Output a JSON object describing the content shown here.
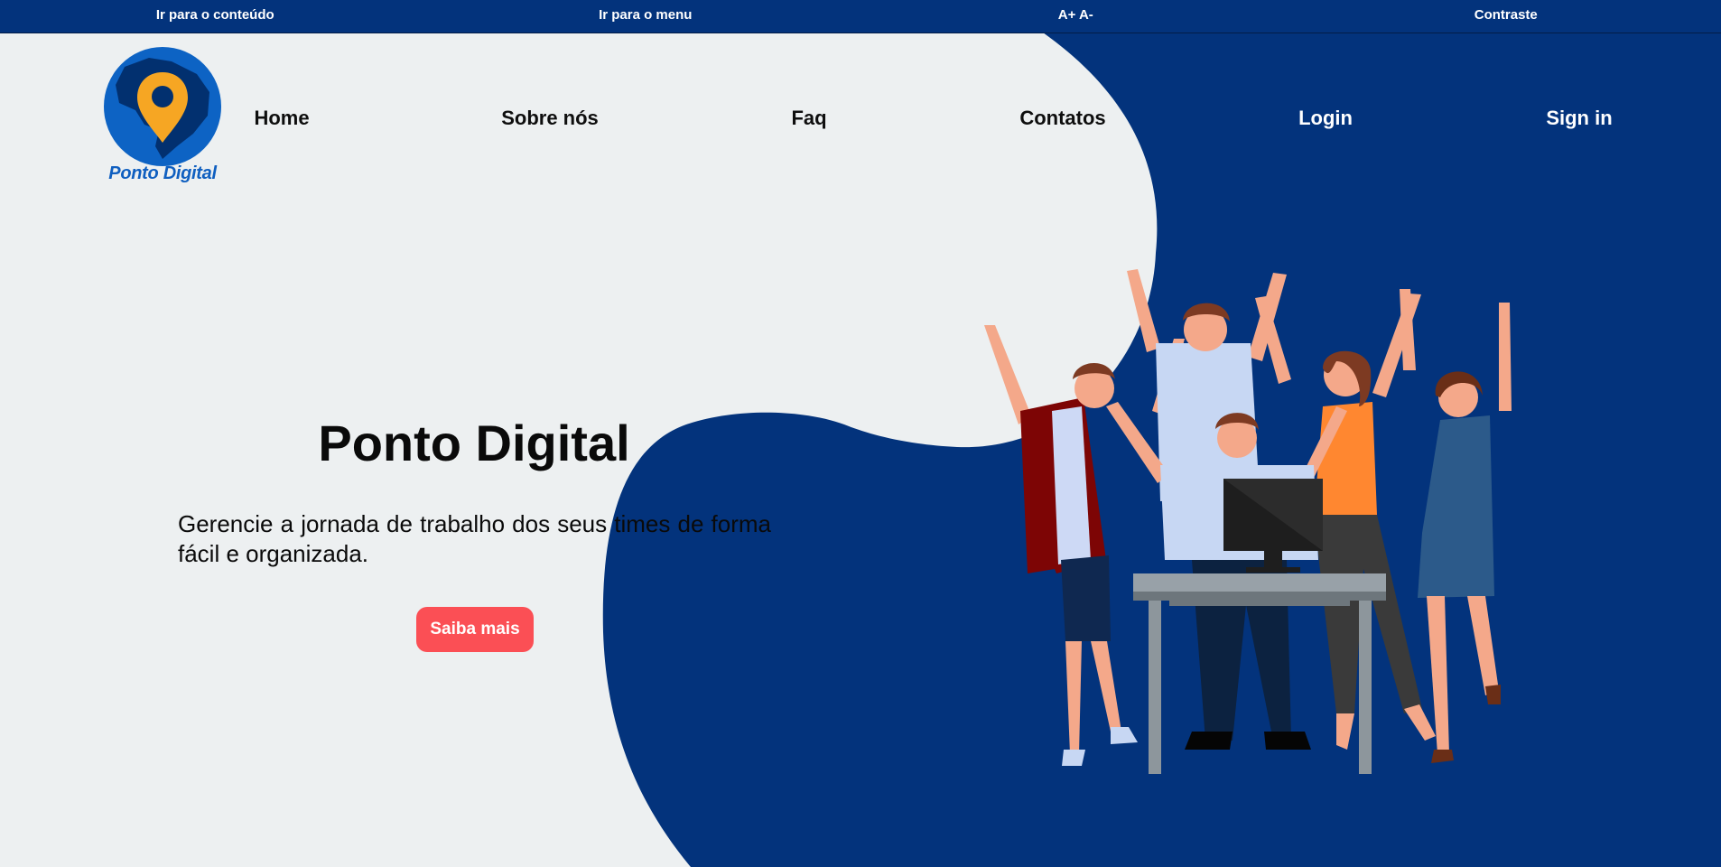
{
  "a11y": {
    "skip_content": "Ir para o conteúdo",
    "skip_menu": "Ir para o menu",
    "font_size": "A+ A-",
    "contrast": "Contraste"
  },
  "brand": {
    "name": "Ponto Digital"
  },
  "nav": {
    "home": "Home",
    "about": "Sobre nós",
    "faq": "Faq",
    "contacts": "Contatos",
    "login": "Login",
    "signin": "Sign in"
  },
  "hero": {
    "title": "Ponto Digital",
    "description": "Gerencie a jornada de trabalho dos seus times de forma fácil e organizada.",
    "cta": "Saiba mais"
  },
  "colors": {
    "navy": "#03337c",
    "background": "#edf0f1",
    "cta": "#fb4f55",
    "pin": "#f6a623",
    "logo_blue": "#0f5fc0"
  },
  "icons": {
    "logo": "map-pin-on-brazil-icon",
    "illustration": "celebrating-team-illustration"
  }
}
